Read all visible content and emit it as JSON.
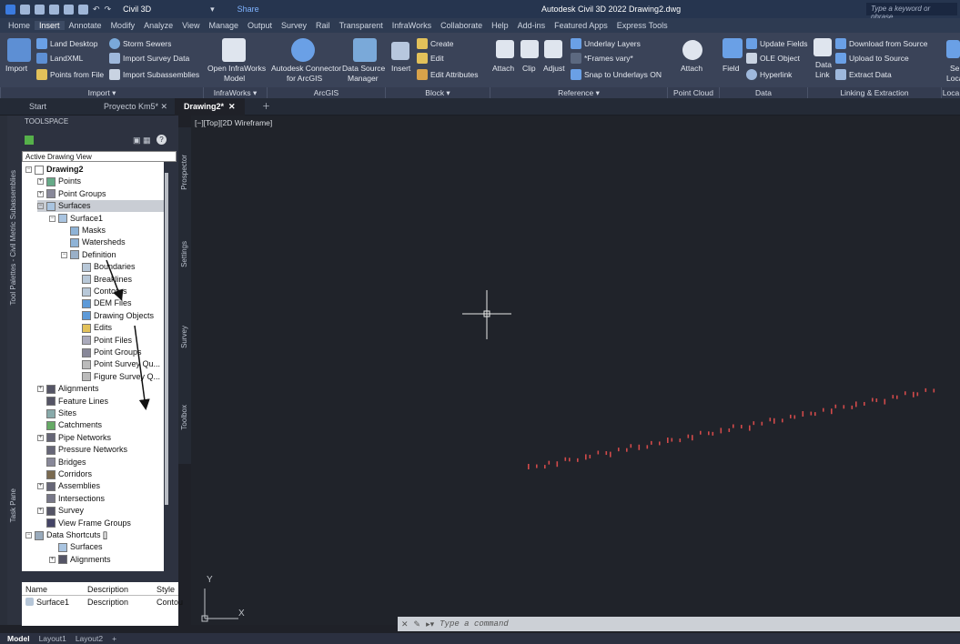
{
  "titlebar": {
    "workspace": "Civil 3D",
    "share": "Share",
    "app_title": "Autodesk Civil 3D 2022   Drawing2.dwg",
    "search_placeholder": "Type a keyword or phrase"
  },
  "menu": [
    "Home",
    "Insert",
    "Annotate",
    "Modify",
    "Analyze",
    "View",
    "Manage",
    "Output",
    "Survey",
    "Rail",
    "Transparent",
    "InfraWorks",
    "Collaborate",
    "Help",
    "Add-ins",
    "Featured Apps",
    "Express Tools"
  ],
  "ribbon": {
    "import": {
      "big": "Import",
      "land_desktop": "Land Desktop",
      "storm_sewers": "Storm Sewers",
      "landxml": "LandXML",
      "import_survey": "Import Survey Data",
      "points_from_file": "Points from File",
      "import_subassemblies": "Import Subassemblies",
      "panel": "Import ▾"
    },
    "infraworks": {
      "open": "Open InfraWorks",
      "open2": "Model",
      "panel": "InfraWorks ▾"
    },
    "arcgis": {
      "connector": "Autodesk Connector",
      "connector2": "for ArcGIS",
      "ds": "Data Source",
      "ds2": "Manager",
      "panel": "ArcGIS"
    },
    "block": {
      "insert": "Insert",
      "create": "Create",
      "edit": "Edit",
      "edit_attributes": "Edit Attributes",
      "panel": "Block ▾"
    },
    "reference": {
      "attach": "Attach",
      "clip": "Clip",
      "adjust": "Adjust",
      "underlay_layers": "Underlay Layers",
      "frames": "*Frames vary*",
      "snap": "Snap to Underlays ON",
      "panel": "Reference ▾"
    },
    "pointcloud": {
      "attach": "Attach",
      "panel": "Point Cloud"
    },
    "data": {
      "field": "Field",
      "update_fields": "Update Fields",
      "ole": "OLE Object",
      "hyperlink": "Hyperlink",
      "panel": "Data"
    },
    "linking": {
      "data_link": "Data",
      "data_link2": "Link",
      "download": "Download from Source",
      "upload": "Upload to Source",
      "extract": "Extract Data",
      "panel": "Linking & Extraction"
    },
    "location": {
      "set": "Se",
      "loca": "Loca",
      "panel": "Loca"
    }
  },
  "doc_tabs": [
    "Start",
    "Proyecto Km5*",
    "Drawing2*"
  ],
  "toolspace": {
    "title": "TOOLSPACE",
    "view_select": "Active Drawing View",
    "vtabs": [
      "Prospector",
      "Settings",
      "Survey",
      "Toolbox"
    ],
    "side_palettes": "Tool Palettes - Civil Metric Subassemblies",
    "task_pane": "Task Pane"
  },
  "tree": [
    {
      "label": "Drawing2",
      "bold": true
    },
    {
      "label": "Points"
    },
    {
      "label": "Point Groups"
    },
    {
      "label": "Surfaces"
    },
    {
      "label": "Surface1"
    },
    {
      "label": "Masks"
    },
    {
      "label": "Watersheds"
    },
    {
      "label": "Definition"
    },
    {
      "label": "Boundaries"
    },
    {
      "label": "Breaklines"
    },
    {
      "label": "Contours"
    },
    {
      "label": "DEM Files"
    },
    {
      "label": "Drawing Objects"
    },
    {
      "label": "Edits"
    },
    {
      "label": "Point Files"
    },
    {
      "label": "Point Groups"
    },
    {
      "label": "Point Survey Qu..."
    },
    {
      "label": "Figure Survey Q..."
    },
    {
      "label": "Alignments"
    },
    {
      "label": "Feature Lines"
    },
    {
      "label": "Sites"
    },
    {
      "label": "Catchments"
    },
    {
      "label": "Pipe Networks"
    },
    {
      "label": "Pressure Networks"
    },
    {
      "label": "Bridges"
    },
    {
      "label": "Corridors"
    },
    {
      "label": "Assemblies"
    },
    {
      "label": "Intersections"
    },
    {
      "label": "Survey"
    },
    {
      "label": "View Frame Groups"
    },
    {
      "label": "Data Shortcuts []"
    },
    {
      "label": "Surfaces"
    },
    {
      "label": "Alignments"
    }
  ],
  "grid": {
    "headers": [
      "Name",
      "Description",
      "Style"
    ],
    "row": [
      "Surface1",
      "Description",
      "Contou"
    ]
  },
  "viewport": {
    "label": "[−][Top][2D Wireframe]",
    "axis_y": "Y",
    "axis_x": "X"
  },
  "command": {
    "placeholder": "Type a command"
  },
  "status": [
    "Model",
    "Layout1",
    "Layout2",
    "+"
  ]
}
